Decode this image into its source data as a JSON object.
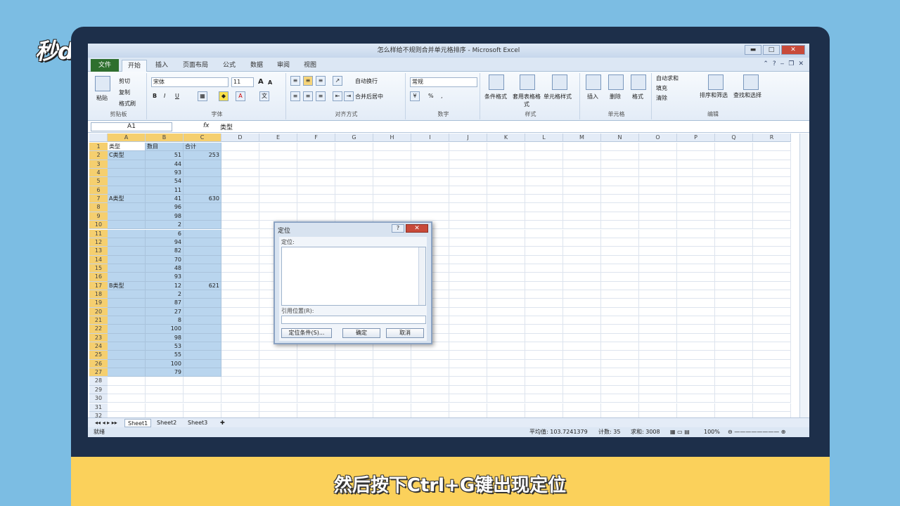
{
  "brand": {
    "logo": "秒dong视频"
  },
  "caption": "然后按下Ctrl+G键出现定位",
  "window": {
    "title": "怎么样给不规则合并单元格排序 - Microsoft Excel",
    "min": "▬",
    "max": "□",
    "close": "✕"
  },
  "ribbon_tabs": {
    "file": "文件",
    "home": "开始",
    "insert": "插入",
    "layout": "页面布局",
    "formulas": "公式",
    "data": "数据",
    "review": "审阅",
    "view": "视图"
  },
  "clipboard": {
    "paste": "粘贴",
    "cut": "剪切",
    "copy": "复制",
    "format_painter": "格式刷",
    "label": "剪贴板"
  },
  "font": {
    "name": "宋体",
    "size": "11",
    "bold": "B",
    "italic": "I",
    "underline": "U",
    "label": "字体",
    "grow": "A",
    "shrink": "A"
  },
  "alignment": {
    "wrap": "自动换行",
    "merge": "合并后居中",
    "label": "对齐方式"
  },
  "number": {
    "format": "常规",
    "label": "数字",
    "percent": "%",
    "comma": ","
  },
  "styles": {
    "conditional": "条件格式",
    "table": "套用表格格式",
    "cell_styles": "单元格样式",
    "label": "样式"
  },
  "cells": {
    "insert": "插入",
    "delete": "删除",
    "format": "格式",
    "label": "单元格"
  },
  "editing": {
    "autosum": "自动求和",
    "fill": "填充",
    "clear": "清除",
    "sort": "排序和筛选",
    "find": "查找和选择",
    "label": "编辑"
  },
  "formula_bar": {
    "name_box": "A1",
    "fx": "fx",
    "content": "类型"
  },
  "columns": [
    "A",
    "B",
    "C",
    "D",
    "E",
    "F",
    "G",
    "H",
    "I",
    "J",
    "K",
    "L",
    "M",
    "N",
    "O",
    "P",
    "Q",
    "R"
  ],
  "rows": [
    {
      "n": "1",
      "a": "类型",
      "b": "数目",
      "c": "合计"
    },
    {
      "n": "2",
      "a": "C类型",
      "b": "51",
      "c": "253"
    },
    {
      "n": "3",
      "a": "",
      "b": "44",
      "c": ""
    },
    {
      "n": "4",
      "a": "",
      "b": "93",
      "c": ""
    },
    {
      "n": "5",
      "a": "",
      "b": "54",
      "c": ""
    },
    {
      "n": "6",
      "a": "",
      "b": "11",
      "c": ""
    },
    {
      "n": "7",
      "a": "A类型",
      "b": "41",
      "c": "630"
    },
    {
      "n": "8",
      "a": "",
      "b": "96",
      "c": ""
    },
    {
      "n": "9",
      "a": "",
      "b": "98",
      "c": ""
    },
    {
      "n": "10",
      "a": "",
      "b": "2",
      "c": ""
    },
    {
      "n": "11",
      "a": "",
      "b": "6",
      "c": ""
    },
    {
      "n": "12",
      "a": "",
      "b": "94",
      "c": ""
    },
    {
      "n": "13",
      "a": "",
      "b": "82",
      "c": ""
    },
    {
      "n": "14",
      "a": "",
      "b": "70",
      "c": ""
    },
    {
      "n": "15",
      "a": "",
      "b": "48",
      "c": ""
    },
    {
      "n": "16",
      "a": "",
      "b": "93",
      "c": ""
    },
    {
      "n": "17",
      "a": "B类型",
      "b": "12",
      "c": "621"
    },
    {
      "n": "18",
      "a": "",
      "b": "2",
      "c": ""
    },
    {
      "n": "19",
      "a": "",
      "b": "87",
      "c": ""
    },
    {
      "n": "20",
      "a": "",
      "b": "27",
      "c": ""
    },
    {
      "n": "21",
      "a": "",
      "b": "8",
      "c": ""
    },
    {
      "n": "22",
      "a": "",
      "b": "100",
      "c": ""
    },
    {
      "n": "23",
      "a": "",
      "b": "98",
      "c": ""
    },
    {
      "n": "24",
      "a": "",
      "b": "53",
      "c": ""
    },
    {
      "n": "25",
      "a": "",
      "b": "55",
      "c": ""
    },
    {
      "n": "26",
      "a": "",
      "b": "100",
      "c": ""
    },
    {
      "n": "27",
      "a": "",
      "b": "79",
      "c": ""
    },
    {
      "n": "28",
      "a": "",
      "b": "",
      "c": ""
    },
    {
      "n": "29",
      "a": "",
      "b": "",
      "c": ""
    },
    {
      "n": "30",
      "a": "",
      "b": "",
      "c": ""
    },
    {
      "n": "31",
      "a": "",
      "b": "",
      "c": ""
    },
    {
      "n": "32",
      "a": "",
      "b": "",
      "c": ""
    }
  ],
  "dialog": {
    "title": "定位",
    "help": "?",
    "close": "✕",
    "list_label": "定位:",
    "ref_label": "引用位置(R):",
    "special": "定位条件(S)...",
    "ok": "确定",
    "cancel": "取消"
  },
  "sheets": [
    "Sheet1",
    "Sheet2",
    "Sheet3"
  ],
  "status": {
    "mode": "就绪",
    "average": "平均值: 103.7241379",
    "count": "计数: 35",
    "sum": "求和: 3008",
    "zoom": "100%"
  }
}
